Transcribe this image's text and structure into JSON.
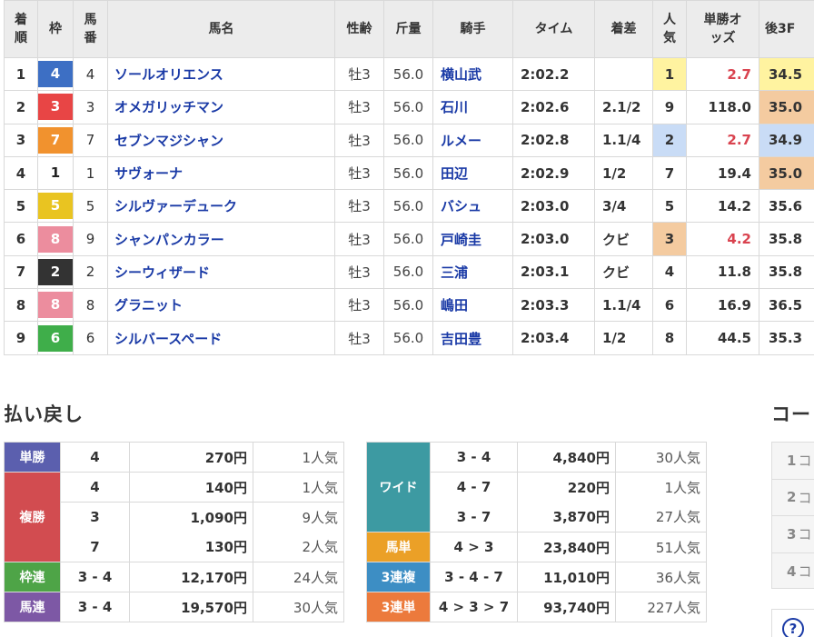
{
  "results": {
    "headers": {
      "rank": "着順",
      "waku": "枠",
      "num": "馬番",
      "name": "馬名",
      "sex_age": "性齢",
      "weight": "斤量",
      "jockey": "騎手",
      "time": "タイム",
      "margin": "着差",
      "pop": "人気",
      "odds": "単勝オッズ",
      "last3f": "後3F"
    },
    "rows": [
      {
        "rank": "1",
        "waku": "4",
        "num": "4",
        "name": "ソールオリエンス",
        "sex_age": "牡3",
        "weight": "56.0",
        "jockey": "横山武",
        "time": "2:02.2",
        "margin": "",
        "pop": "1",
        "odds": "2.7",
        "last3f": "34.5"
      },
      {
        "rank": "2",
        "waku": "3",
        "num": "3",
        "name": "オメガリッチマン",
        "sex_age": "牡3",
        "weight": "56.0",
        "jockey": "石川",
        "time": "2:02.6",
        "margin": "2.1/2",
        "pop": "9",
        "odds": "118.0",
        "last3f": "35.0"
      },
      {
        "rank": "3",
        "waku": "7",
        "num": "7",
        "name": "セブンマジシャン",
        "sex_age": "牡3",
        "weight": "56.0",
        "jockey": "ルメー",
        "time": "2:02.8",
        "margin": "1.1/4",
        "pop": "2",
        "odds": "2.7",
        "last3f": "34.9"
      },
      {
        "rank": "4",
        "waku": "1",
        "num": "1",
        "name": "サヴォーナ",
        "sex_age": "牡3",
        "weight": "56.0",
        "jockey": "田辺",
        "time": "2:02.9",
        "margin": "1/2",
        "pop": "7",
        "odds": "19.4",
        "last3f": "35.0"
      },
      {
        "rank": "5",
        "waku": "5",
        "num": "5",
        "name": "シルヴァーデューク",
        "sex_age": "牡3",
        "weight": "56.0",
        "jockey": "バシュ",
        "time": "2:03.0",
        "margin": "3/4",
        "pop": "5",
        "odds": "14.2",
        "last3f": "35.6"
      },
      {
        "rank": "6",
        "waku": "8",
        "num": "9",
        "name": "シャンパンカラー",
        "sex_age": "牡3",
        "weight": "56.0",
        "jockey": "戸崎圭",
        "time": "2:03.0",
        "margin": "クビ",
        "pop": "3",
        "odds": "4.2",
        "last3f": "35.8"
      },
      {
        "rank": "7",
        "waku": "2",
        "num": "2",
        "name": "シーウィザード",
        "sex_age": "牡3",
        "weight": "56.0",
        "jockey": "三浦",
        "time": "2:03.1",
        "margin": "クビ",
        "pop": "4",
        "odds": "11.8",
        "last3f": "35.8"
      },
      {
        "rank": "8",
        "waku": "8",
        "num": "8",
        "name": "グラニット",
        "sex_age": "牡3",
        "weight": "56.0",
        "jockey": "嶋田",
        "time": "2:03.3",
        "margin": "1.1/4",
        "pop": "6",
        "odds": "16.9",
        "last3f": "36.5"
      },
      {
        "rank": "9",
        "waku": "6",
        "num": "6",
        "name": "シルバースペード",
        "sex_age": "牡3",
        "weight": "56.0",
        "jockey": "吉田豊",
        "time": "2:03.4",
        "margin": "1/2",
        "pop": "8",
        "odds": "44.5",
        "last3f": "35.3"
      }
    ]
  },
  "payout": {
    "title": "払い戻し",
    "left": {
      "tansho": {
        "label": "単勝",
        "combo": "4",
        "yen": "270円",
        "pop": "1人気"
      },
      "fukusho": {
        "label": "複勝",
        "items": [
          {
            "combo": "4",
            "yen": "140円",
            "pop": "1人気"
          },
          {
            "combo": "3",
            "yen": "1,090円",
            "pop": "9人気"
          },
          {
            "combo": "7",
            "yen": "130円",
            "pop": "2人気"
          }
        ]
      },
      "wakuren": {
        "label": "枠連",
        "combo": "3 - 4",
        "yen": "12,170円",
        "pop": "24人気"
      },
      "umaren": {
        "label": "馬連",
        "combo": "3 - 4",
        "yen": "19,570円",
        "pop": "30人気"
      }
    },
    "right": {
      "wide": {
        "label": "ワイド",
        "items": [
          {
            "combo": "3 - 4",
            "yen": "4,840円",
            "pop": "30人気"
          },
          {
            "combo": "4 - 7",
            "yen": "220円",
            "pop": "1人気"
          },
          {
            "combo": "3 - 7",
            "yen": "3,870円",
            "pop": "27人気"
          }
        ]
      },
      "umatan": {
        "label": "馬単",
        "combo": "4 > 3",
        "yen": "23,840円",
        "pop": "51人気"
      },
      "sanrenpuku": {
        "label": "3連複",
        "combo": "3 - 4 - 7",
        "yen": "11,010円",
        "pop": "36人気"
      },
      "sanrentan": {
        "label": "3連単",
        "combo": "4 > 3 > 7",
        "yen": "93,740円",
        "pop": "227人気"
      }
    }
  },
  "course": {
    "title": "コー",
    "items": [
      {
        "n": "1",
        "t": "コ"
      },
      {
        "n": "2",
        "t": "コ"
      },
      {
        "n": "3",
        "t": "コ"
      },
      {
        "n": "4",
        "t": "コ"
      }
    ],
    "help": "?"
  },
  "colors": {
    "waku": {
      "1": "#ffffff",
      "2": "#333333",
      "3": "#e84545",
      "4": "#3d6fc4",
      "5": "#e9c421",
      "6": "#3fae4a",
      "7": "#f1922e",
      "8": "#ec8d9e"
    },
    "link": "#1a3aa6",
    "fav_odds": "#d9434f",
    "pop1": "#fff3a0",
    "pop2": "#c9dcf6",
    "pop3": "#f4cba0"
  }
}
